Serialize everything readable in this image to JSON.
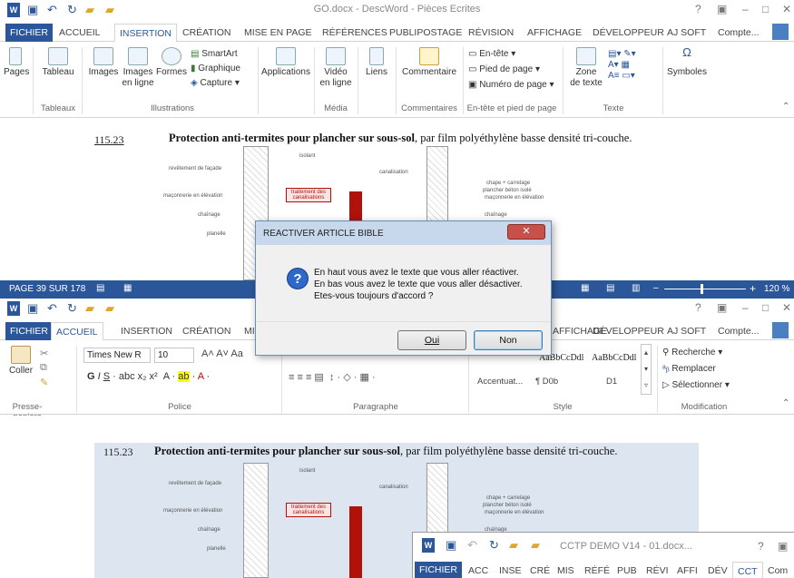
{
  "top": {
    "title": "GO.docx - DescWord - Pièces Ecrites",
    "tabs": [
      "FICHIER",
      "ACCUEIL",
      "INSERTION",
      "CRÉATION",
      "MISE EN PAGE",
      "RÉFÉRENCES",
      "PUBLIPOSTAGE",
      "RÉVISION",
      "AFFICHAGE",
      "DÉVELOPPEUR",
      "AJ SOFT",
      "Compte..."
    ],
    "ribbon": {
      "pages": "Pages",
      "tableau": "Tableau",
      "images": "Images",
      "images_ligne": "Images en ligne",
      "formes": "Formes",
      "smartart": "SmartArt",
      "graphique": "Graphique",
      "capture": "Capture",
      "applications": "Applications",
      "video": "Vidéo en ligne",
      "liens": "Liens",
      "commentaire": "Commentaire",
      "entete": "En-tête",
      "pied": "Pied de page",
      "numero": "Numéro de page",
      "zone_texte": "Zone de texte",
      "symboles": "Symboles",
      "g_tableaux": "Tableaux",
      "g_illus": "Illustrations",
      "g_media": "Média",
      "g_comm": "Commentaires",
      "g_entete": "En-tête et pied de page",
      "g_texte": "Texte"
    },
    "heading_num": "115.23",
    "heading_bold": "Protection anti-termites pour plancher sur sous-sol",
    "heading_rest": ", par film polyéthylène basse densité tri-couche.",
    "status": {
      "page": "PAGE 39 SUR 178",
      "zoom": "120 %"
    }
  },
  "figure_labels": {
    "isolant": "isolant",
    "revetement": "revêtement de façade",
    "canalisation": "canalisation",
    "traitement": "traitement des canalisations",
    "chape": "chape + carrelage",
    "plancher": "plancher béton isolé",
    "maconnerie": "maçonnerie en élévation",
    "chainage": "chaînage",
    "planelle": "planelle"
  },
  "bottom": {
    "tabs": [
      "FICHIER",
      "ACCUEIL",
      "INSERTION",
      "CRÉATION",
      "MI",
      "AFFICHAGE",
      "DÉVELOPPEUR",
      "AJ SOFT",
      "Compte..."
    ],
    "coller": "Coller",
    "font": "Times New R",
    "size": "10",
    "g_presse": "Presse-papiers",
    "g_police": "Police",
    "g_para": "Paragraphe",
    "g_style": "Style",
    "g_modif": "Modification",
    "styles": [
      "Accentuat...",
      "¶ D0b",
      "D1"
    ],
    "style_prev": [
      "AaBbCcDdl",
      "AaBbCcDdl"
    ],
    "rechercher": "Recherche",
    "remplacer": "Remplacer",
    "selectionner": "Sélectionner",
    "heading_num": "115.23",
    "heading_bold": "Protection anti-termites pour plancher sur sous-sol",
    "heading_rest": ", par film polyéthylène basse densité tri-couche."
  },
  "third": {
    "title": "CCTP DEMO V14 - 01.docx...",
    "tabs": [
      "FICHIER",
      "ACC",
      "INSE",
      "CRÉ",
      "MIS",
      "RÉFÉ",
      "PUB",
      "RÉVI",
      "AFFI",
      "DÉV",
      "CCT",
      "Com"
    ]
  },
  "dialog": {
    "title": "REACTIVER ARTICLE BIBLE",
    "line1": "En haut vous avez le texte que vous aller réactiver.",
    "line2": "En bas vous avez le texte que vous aller désactiver.",
    "line3": "Etes-vous  toujours d'accord  ?",
    "oui": "Oui",
    "non": "Non"
  },
  "colors": {
    "accent": "#2b579a",
    "dialog_close": "#c7504a"
  }
}
